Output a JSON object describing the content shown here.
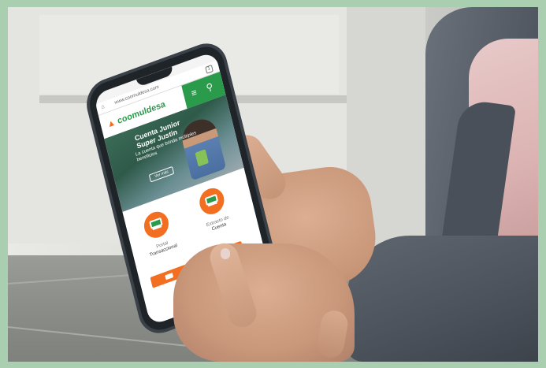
{
  "browser": {
    "url": "www.coomuldesa.com",
    "tab_count": "1"
  },
  "site": {
    "brand": "coomuldesa",
    "hero": {
      "title_line1": "Cuenta Junior",
      "title_line2": "Super Justin",
      "subtitle_line1": "La cuenta que brinda múltiples",
      "subtitle_line2": "beneficios",
      "button": "Ver más"
    },
    "services": [
      {
        "label_line1": "Portal",
        "label_line2": "Transaccional"
      },
      {
        "label_line1": "Extracto de",
        "label_line2": "Cuenta"
      }
    ]
  },
  "icons": [
    "home-icon",
    "menu-icon",
    "search-icon",
    "laptop-icon",
    "mail-icon"
  ],
  "colors": {
    "brand_green": "#2a9a4b",
    "brand_orange": "#f26f22",
    "frame": "#a9cfb0"
  }
}
